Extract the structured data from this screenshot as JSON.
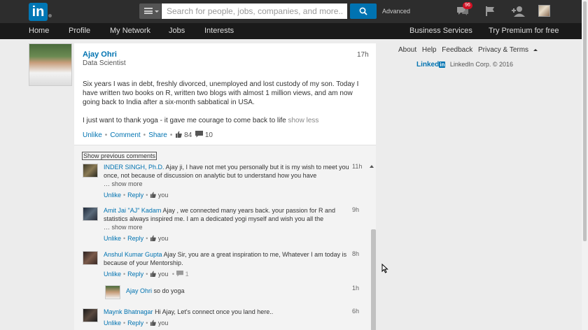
{
  "header": {
    "logo_text": "in",
    "search_placeholder": "Search for people, jobs, companies, and more...",
    "advanced_label": "Advanced",
    "messages_badge": "96",
    "icons": [
      "messages-icon",
      "flag-icon",
      "add-connection-icon",
      "profile-avatar"
    ]
  },
  "nav": {
    "items": [
      "Home",
      "Profile",
      "My Network",
      "Jobs",
      "Interests"
    ],
    "right_items": [
      "Business Services",
      "Try Premium for free"
    ]
  },
  "post": {
    "author": "Ajay Ohri",
    "headline": "Data Scientist",
    "time": "17h",
    "body": "Six years I was in debt, freshly divorced, unemployed and lost custody of my son. Today I have written two books on R, written two blogs with almost 1 million views, and am now going back to India after a six-month sabbatical in USA.",
    "body2": "I just want to thank yoga - it gave me courage to come back to life",
    "show_less": "show less",
    "actions": {
      "unlike": "Unlike",
      "comment": "Comment",
      "share": "Share",
      "likes": "84",
      "comments_count": "10"
    }
  },
  "comments": {
    "show_previous": "Show previous comments",
    "items": [
      {
        "name": "INDER SINGH, Ph.D.",
        "text": "Ajay ji, I have not met you personally but it is my wish to meet you once, not because of discussion on analytic but to understand how you have",
        "more": "… show more",
        "time": "11h",
        "unlike": "Unlike",
        "reply": "Reply",
        "likes": "you"
      },
      {
        "name": "Amit Jai \"AJ\" Kadam",
        "text": "Ajay , we connected many years back. your passion for R and statistics always inspired me. I am a dedicated yogi myself and wish you all the",
        "more": "… show more",
        "time": "9h",
        "unlike": "Unlike",
        "reply": "Reply",
        "likes": "you"
      },
      {
        "name": "Anshul Kumar Gupta",
        "text": "Ajay Sir, you are a great inspiration to me, Whatever I am today is because of your Mentorship.",
        "time": "8h",
        "unlike": "Unlike",
        "reply": "Reply",
        "likes": "you",
        "replies_count": "1"
      },
      {
        "name": "Ajay Ohri",
        "text": "so do yoga",
        "time": "1h"
      },
      {
        "name": "Maynk Bhatnagar",
        "text": "Hi Ajay, Let's connect once you land here..",
        "time": "6h",
        "unlike": "Unlike",
        "reply": "Reply",
        "likes": "you"
      }
    ]
  },
  "rail": {
    "links": [
      "About",
      "Help",
      "Feedback",
      "Privacy & Terms"
    ],
    "brand_text": "Linked",
    "brand_in": "in",
    "copyright": "LinkedIn Corp. © 2016"
  },
  "colors": {
    "brand": "#0073b1",
    "topbar": "#2d2d2d",
    "navbar": "#1a1a1a",
    "badge": "#d11124"
  }
}
